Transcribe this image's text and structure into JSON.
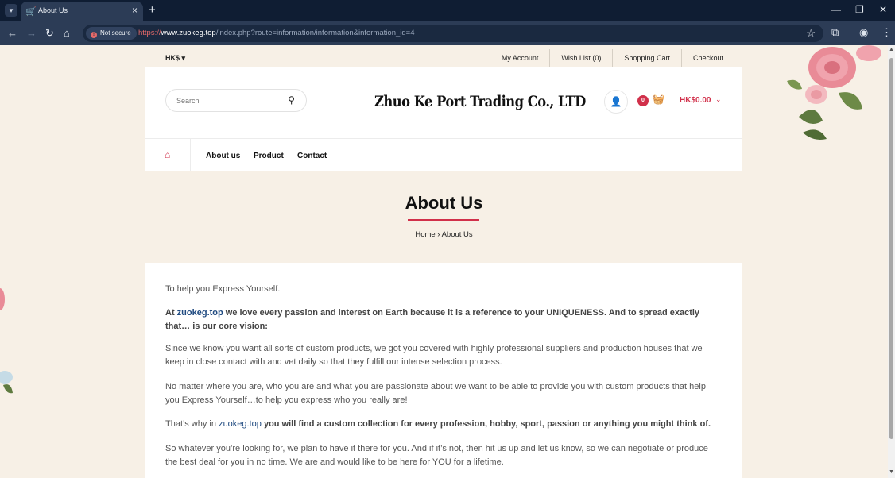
{
  "browser": {
    "tab_title": "About Us",
    "security_label": "Not secure",
    "url_scheme": "https://",
    "url_host": "www.zuokeg.top",
    "url_path": "/index.php?route=information/information&information_id=4"
  },
  "topbar": {
    "currency": "HK$",
    "links": [
      "My Account",
      "Wish List (0)",
      "Shopping Cart",
      "Checkout"
    ]
  },
  "header": {
    "search_placeholder": "Search",
    "logo_text": "Zhuo Ke Port Trading Co., LTD",
    "cart_count": "0",
    "cart_total": "HK$0.00"
  },
  "menu": {
    "items": [
      "About us",
      "Product",
      "Contact"
    ]
  },
  "page": {
    "title": "About Us",
    "breadcrumb_home": "Home",
    "breadcrumb_sep": " › ",
    "breadcrumb_current": "About Us"
  },
  "content": {
    "p1": "To help you Express Yourself.",
    "p2_prefix": "At ",
    "p2_link": "zuokeg.top",
    "p2_rest": " we love every passion and interest on Earth because it is a reference to your UNIQUENESS. And to spread exactly that… is our core vision:",
    "p3": "Since we know you want all sorts of custom products, we got you covered with highly professional suppliers and production houses that we keep in close contact with and vet daily so that they fulfill our intense selection process.",
    "p4": "No matter where you are, who you are and what you are passionate about we want to be able to provide you with custom products that help you Express Yourself…to help you express who you really are!",
    "p5_prefix": "That’s why in ",
    "p5_link": "zuokeg.top",
    "p5_rest": " you will find a custom collection for every profession, hobby, sport, passion or anything you might think of.",
    "p6": "So whatever you’re looking for, we plan to have it there for you. And if it’s not, then hit us up and let us know, so we can negotiate or produce the best deal for you in no time. We are and would like to be here for YOU for a lifetime."
  },
  "colors": {
    "accent": "#d1304a",
    "chrome_dark": "#0f1d33",
    "chrome_toolbar": "#2c3c56",
    "page_bg": "#f7f0e6"
  }
}
